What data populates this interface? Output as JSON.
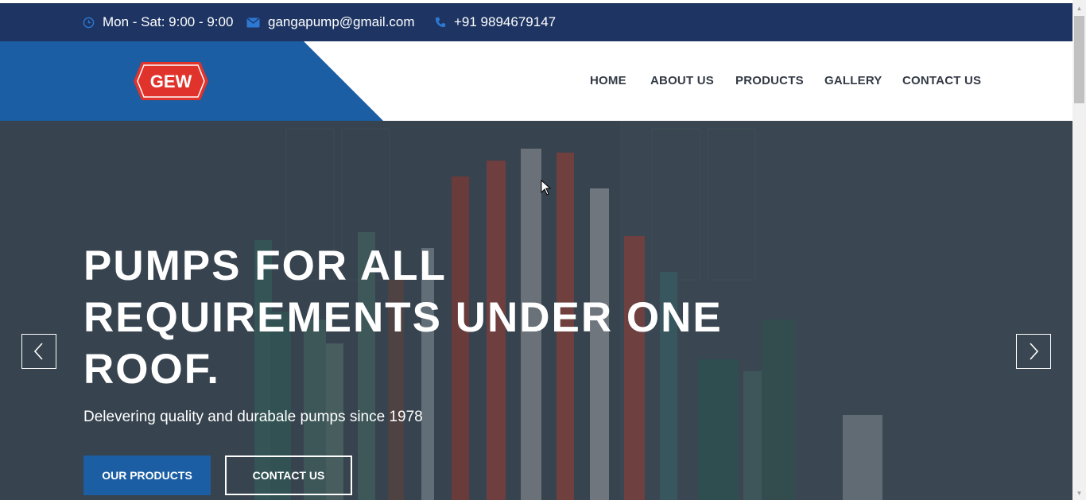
{
  "topbar": {
    "hours": "Mon - Sat: 9:00 - 9:00",
    "email": "gangapump@gmail.com",
    "phone": "+91 9894679147",
    "icons": [
      "clock-icon",
      "envelope-icon",
      "phone-icon"
    ]
  },
  "logo": {
    "text": "GEW"
  },
  "nav": {
    "items": [
      {
        "label": "HOME"
      },
      {
        "label": "ABOUT US"
      },
      {
        "label": "PRODUCTS"
      },
      {
        "label": "GALLERY"
      },
      {
        "label": "CONTACT US"
      }
    ]
  },
  "hero": {
    "title": "PUMPS FOR ALL REQUIREMENTS UNDER ONE ROOF.",
    "subtitle": "Delevering quality and durabale pumps since 1978",
    "primary_button": "OUR PRODUCTS",
    "secondary_button": "CONTACT US"
  },
  "colors": {
    "topbar_bg": "#1e3563",
    "brand_blue": "#1b5ea3",
    "logo_red": "#e0332b",
    "nav_text": "#333a45",
    "hero_overlay": "#3d4b56"
  }
}
